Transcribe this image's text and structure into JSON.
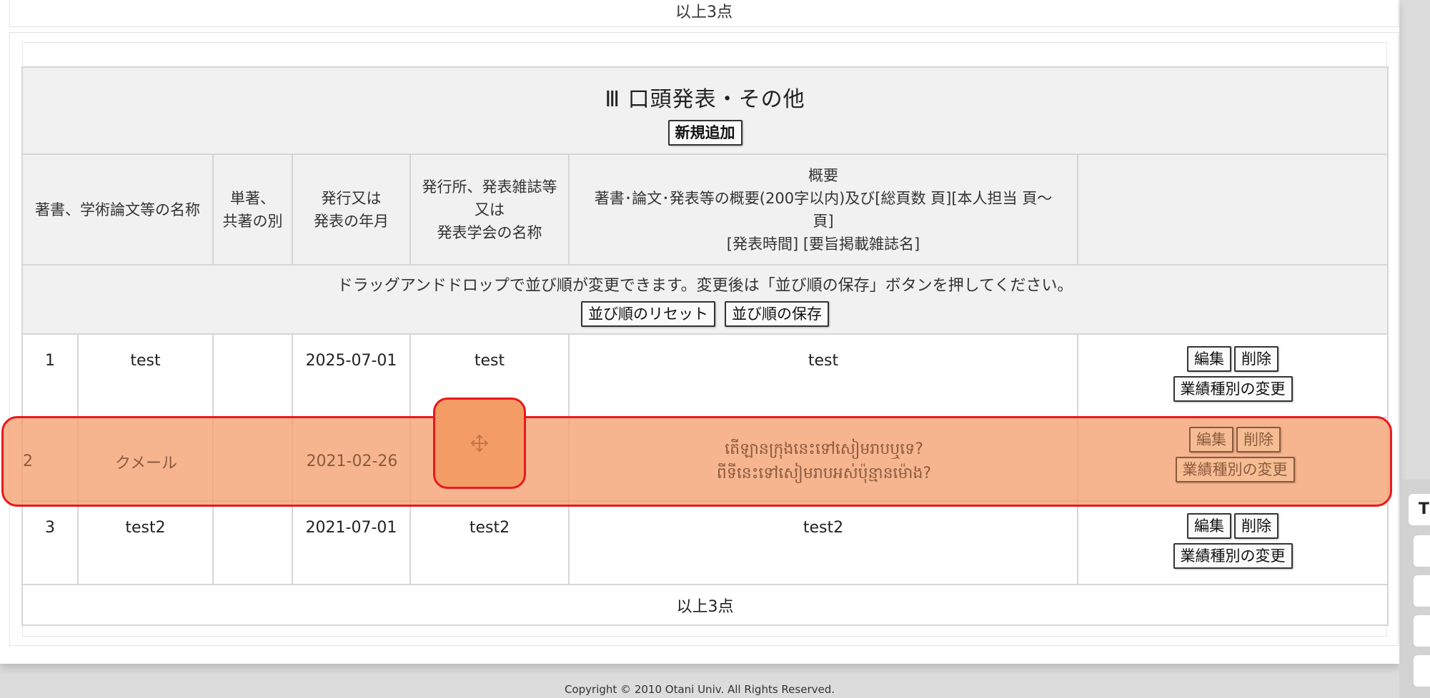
{
  "prev_section": {
    "footer": "以上3点"
  },
  "section": {
    "title": "Ⅲ 口頭発表・その他",
    "add_button": "新規追加",
    "columns": {
      "name": "著書、学術論文等の名称",
      "authorship_line1": "単著、",
      "authorship_line2": "共著の別",
      "date_line1": "発行又は",
      "date_line2": "発表の年月",
      "publisher_line1": "発行所、発表雑誌等",
      "publisher_line2": "又は",
      "publisher_line3": "発表学会の名称",
      "summary_line1": "概要",
      "summary_line2": "著書･論文･発表等の概要(200字以内)及び[総頁数 頁][本人担当 頁～",
      "summary_line3": "頁]",
      "summary_line4": "[発表時間] [要旨掲載雑誌名]"
    },
    "reorder_note": "ドラッグアンドドロップで並び順が変更できます。変更後は「並び順の保存」ボタンを押してください。",
    "reset_order_button": "並び順のリセット",
    "save_order_button": "並び順の保存",
    "rows": [
      {
        "no": "1",
        "name": "test",
        "authorship": "",
        "date": "2025-07-01",
        "publisher": "test",
        "summary": "test"
      },
      {
        "no": "2",
        "name": "クメール",
        "authorship": "",
        "date": "2021-02-26",
        "publisher": "",
        "summary_line1": "តើឡានក្រុងនេះទៅសៀមរាបឬទេ?",
        "summary_line2": "ពីទីនេះទៅសៀមរាបអស់ប៉ុន្មានម៉ោង?"
      },
      {
        "no": "3",
        "name": "test2",
        "authorship": "",
        "date": "2021-07-01",
        "publisher": "test2",
        "summary": "test2"
      }
    ],
    "edit_button": "編集",
    "delete_button": "削除",
    "change_type_button": "業績種別の変更",
    "footer": "以上3点"
  },
  "copyright": "Copyright © 2010 Otani Univ. All Rights Reserved.",
  "side_widget": {
    "tab_label": "T"
  },
  "colors": {
    "drag_highlight": "#f4a070",
    "drag_border": "#e8191d"
  },
  "icons": {
    "drag_handle": "move-icon"
  }
}
